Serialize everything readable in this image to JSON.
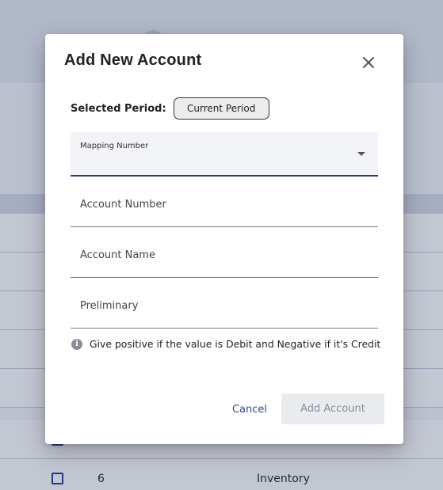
{
  "background": {
    "visible_rows": [
      {
        "number": "",
        "name": ""
      },
      {
        "number": "",
        "name": ""
      },
      {
        "number": "",
        "name": ""
      },
      {
        "number": "",
        "name": ""
      },
      {
        "number": "",
        "name": ""
      },
      {
        "number": "6",
        "name": "Inventory"
      }
    ]
  },
  "dialog": {
    "title": "Add New Account",
    "close_icon": "close-icon",
    "period": {
      "label": "Selected Period:",
      "chip": "Current Period"
    },
    "mapping_number": {
      "label": "Mapping Number",
      "value": ""
    },
    "fields": {
      "account_number": {
        "placeholder": "Account Number",
        "value": ""
      },
      "account_name": {
        "placeholder": "Account Name",
        "value": ""
      },
      "preliminary": {
        "placeholder": "Preliminary",
        "value": ""
      }
    },
    "hint": {
      "icon": "info-icon",
      "text": "Give positive if the value is Debit and Negative if it's Credit"
    },
    "actions": {
      "cancel": "Cancel",
      "submit": "Add Account",
      "submit_disabled": true
    }
  },
  "colors": {
    "primary": "#2f4b8a",
    "field_underline": "#2b3d66",
    "disabled_bg": "#e9ebef",
    "disabled_text": "#8a8f99",
    "overlay": "#28375f"
  }
}
